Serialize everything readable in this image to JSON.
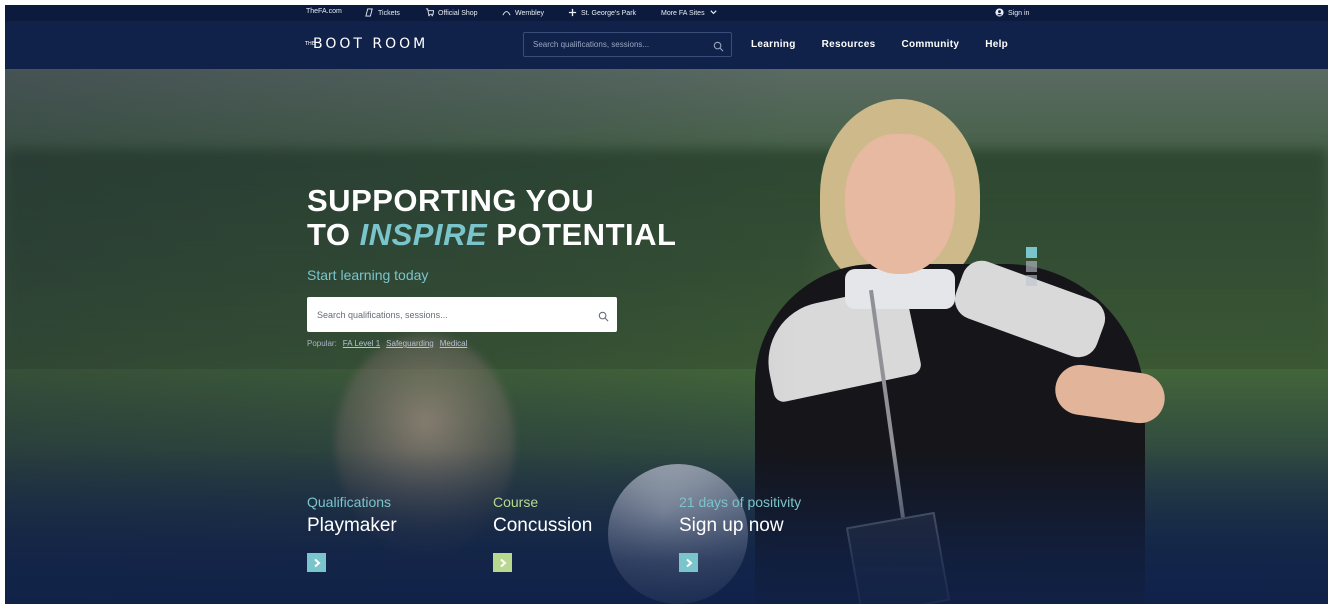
{
  "utility_bar": {
    "links": [
      {
        "label": "TheFA.com",
        "icon": ""
      },
      {
        "label": "Tickets",
        "icon": "ticket-icon"
      },
      {
        "label": "Official Shop",
        "icon": "shopping-cart-icon"
      },
      {
        "label": "Wembley",
        "icon": "wembley-arch-icon"
      },
      {
        "label": "St. George's Park",
        "icon": "st-georges-cross-icon"
      }
    ],
    "more_sites": "More FA Sites",
    "sign_in": "Sign in"
  },
  "nav": {
    "logo": "BOOT ROOM",
    "logo_prefix": "THE",
    "search_placeholder": "Search qualifications, sessions...",
    "links": [
      "Learning",
      "Resources",
      "Community",
      "Help"
    ]
  },
  "hero": {
    "headline_line1": "SUPPORTING YOU",
    "headline_to": "TO",
    "headline_accent": "INSPIRE",
    "headline_end": "POTENTIAL",
    "subhead": "Start learning today",
    "search_placeholder": "Search qualifications, sessions...",
    "popular_label": "Popular:",
    "popular_links": [
      "FA Level 1",
      "Safeguarding",
      "Medical"
    ]
  },
  "promos": [
    {
      "category": "Qualifications",
      "title": "Playmaker",
      "color": "#7ac4cc"
    },
    {
      "category": "Course",
      "title": "Concussion",
      "color": "#b9d88f"
    },
    {
      "category": "21 days of positivity",
      "title": "Sign up now",
      "color": "#7ac4cc"
    }
  ],
  "colors": {
    "navy": "#10224a",
    "accent_teal": "#7ac4cc",
    "accent_green": "#b9d88f"
  },
  "carousel": {
    "slides": 3,
    "active": 1
  }
}
